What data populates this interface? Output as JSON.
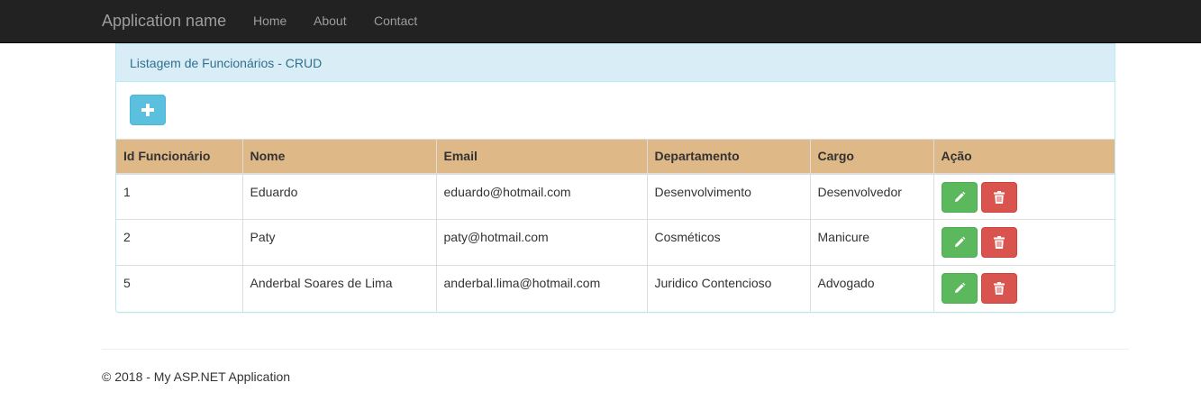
{
  "navbar": {
    "brand": "Application name",
    "links": [
      "Home",
      "About",
      "Contact"
    ],
    "background": "#222222",
    "link_color": "#9d9d9d"
  },
  "panel": {
    "heading": "Listagem de Funcionários - CRUD",
    "heading_color": "#31708f",
    "heading_background": "#d9edf7",
    "add_button_icon": "plus-icon"
  },
  "table": {
    "header_background": "#deb887",
    "columns": [
      "Id Funcionário",
      "Nome",
      "Email",
      "Departamento",
      "Cargo",
      "Ação"
    ],
    "rows": [
      [
        "1",
        "Eduardo",
        "eduardo@hotmail.com",
        "Desenvolvimento",
        "Desenvolvedor"
      ],
      [
        "2",
        "Paty",
        "paty@hotmail.com",
        "Cosméticos",
        "Manicure"
      ],
      [
        "5",
        "Anderbal Soares de Lima",
        "anderbal.lima@hotmail.com",
        "Juridico Contencioso",
        "Advogado"
      ]
    ],
    "edit_icon": "pencil-icon",
    "delete_icon": "trash-icon",
    "edit_color": "#5cb85c",
    "delete_color": "#d9534f"
  },
  "footer": {
    "text": "© 2018 - My ASP.NET Application"
  }
}
